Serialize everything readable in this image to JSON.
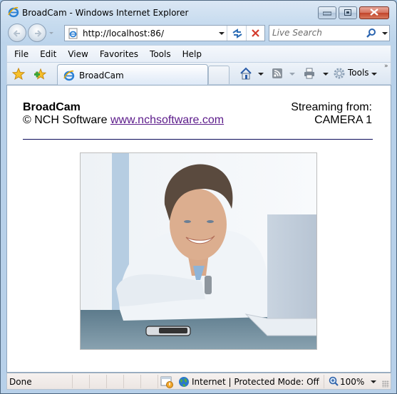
{
  "window": {
    "title": "BroadCam - Windows Internet Explorer",
    "controls": {
      "minimize": "minimize",
      "maximize": "maximize",
      "close": "close"
    }
  },
  "address_bar": {
    "url": "http://localhost:86/",
    "refresh_icon": "refresh-icon",
    "stop_icon": "stop-icon"
  },
  "search": {
    "placeholder": "Live Search",
    "icon": "search-icon"
  },
  "menu": {
    "items": [
      {
        "label": "File"
      },
      {
        "label": "Edit"
      },
      {
        "label": "View"
      },
      {
        "label": "Favorites"
      },
      {
        "label": "Tools"
      },
      {
        "label": "Help"
      }
    ]
  },
  "command_bar": {
    "tab_label": "BroadCam",
    "tools_label": "Tools",
    "overflow": "»"
  },
  "page": {
    "title": "BroadCam",
    "copyright_prefix": "© NCH Software ",
    "link_text": "www.nchsoftware.com",
    "streaming_label": "Streaming from:",
    "camera_name": "CAMERA 1",
    "camera_image_alt": "Live camera feed: smiling man leaning on desk in front of laptop"
  },
  "status_bar": {
    "status": "Done",
    "zone": "Internet | Protected Mode: Off",
    "zoom": "100%"
  },
  "colors": {
    "link_visited": "#5b1a8a",
    "rule": "#0c0c5a",
    "chrome": "#bcd4eb"
  }
}
